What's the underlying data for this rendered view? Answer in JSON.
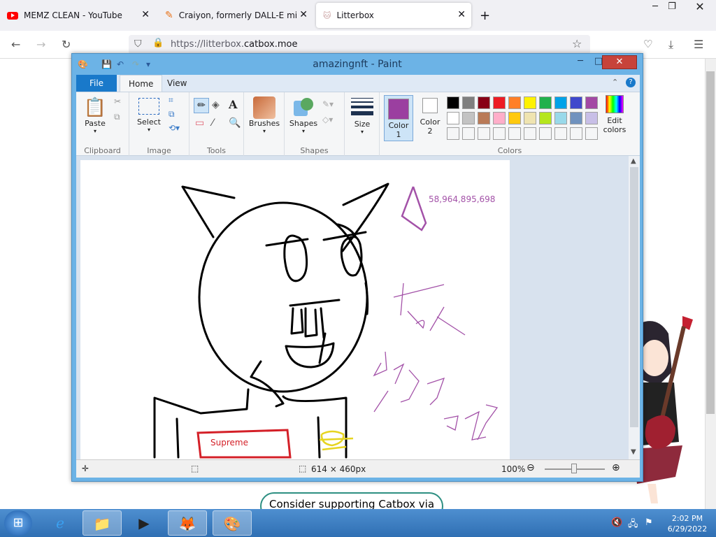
{
  "browser": {
    "tabs": [
      {
        "title": "MEMZ CLEAN - YouTube",
        "icon": "youtube-icon"
      },
      {
        "title": "Craiyon, formerly DALL-E mini",
        "icon": "pencil-icon"
      },
      {
        "title": "Litterbox",
        "icon": "cat-icon"
      }
    ],
    "new_tab": "+",
    "url_prefix": "https://litterbox.",
    "url_domain": "catbox.moe"
  },
  "page": {
    "cta": "Consider supporting Catbox via"
  },
  "paint": {
    "title": "amazingnft - Paint",
    "tabs": {
      "file": "File",
      "home": "Home",
      "view": "View"
    },
    "groups": {
      "clipboard": "Clipboard",
      "image": "Image",
      "tools": "Tools",
      "shapes": "Shapes",
      "colors": "Colors"
    },
    "buttons": {
      "paste": "Paste",
      "select": "Select",
      "brushes": "Brushes",
      "shapes": "Shapes",
      "size": "Size",
      "color1": "Color\n1",
      "color2": "Color\n2",
      "edit_colors": "Edit\ncolors"
    },
    "color1": "#9b3fa0",
    "color2": "#ffffff",
    "palette_row1": [
      "#000000",
      "#7f7f7f",
      "#880015",
      "#ed1c24",
      "#ff7f27",
      "#fff200",
      "#22b14c",
      "#00a2e8",
      "#3f48cc",
      "#a349a4"
    ],
    "palette_row2": [
      "#ffffff",
      "#c3c3c3",
      "#b97a57",
      "#ffaec9",
      "#ffc90e",
      "#efe4b0",
      "#b5e61d",
      "#99d9ea",
      "#7092be",
      "#c8bfe7"
    ],
    "canvas_text": {
      "number": "58,964,895,698",
      "supreme": "Supreme"
    },
    "status": {
      "dimensions": "614 × 460px",
      "zoom": "100%"
    }
  },
  "taskbar": {
    "time": "2:02 PM",
    "date": "6/29/2022"
  }
}
